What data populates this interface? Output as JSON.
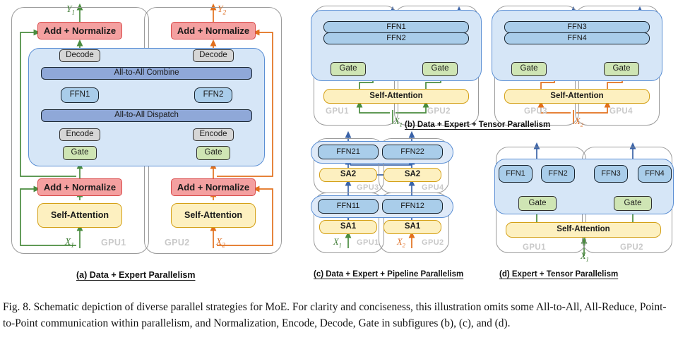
{
  "figure": {
    "caption": "Fig. 8.  Schematic depiction of diverse parallel strategies for MoE. For clarity and conciseness, this illustration omits some All-to-All, All-Reduce, Point-to-Point communication within parallelism, and Normalization, Encode, Decode, Gate in subfigures (b), (c), and (d)."
  },
  "colors": {
    "add_norm": "#f4a0a0",
    "self_attention": "#fdf0c0",
    "gate": "#cfe5b4",
    "encode_decode": "#d6d6d6",
    "ffn": "#a9cdea",
    "all_to_all": "#8fa8d8",
    "moe_region": "#d6e6f7",
    "gpu_border": "#9b9b9b",
    "gpu_label": "#c9c9c9",
    "flow_green": "#4a8c3f",
    "flow_orange": "#e2701c",
    "flow_blue": "#3a63a8",
    "flow_gray": "#9b9b9b"
  },
  "panel_a": {
    "caption": "(a) Data + Expert Parallelism",
    "gpus": [
      "GPU1",
      "GPU2"
    ],
    "inputs": [
      "X",
      "X"
    ],
    "input_subs": [
      "1",
      "2"
    ],
    "outputs": [
      "Y",
      "Y"
    ],
    "output_subs": [
      "1",
      "2"
    ],
    "left_column": {
      "add_norm_top": "Add + Normalize",
      "decode": "Decode",
      "ffn": "FFN1",
      "encode": "Encode",
      "gate": "Gate",
      "add_norm_bottom": "Add + Normalize",
      "self_attention": "Self-Attention"
    },
    "right_column": {
      "add_norm_top": "Add + Normalize",
      "decode": "Decode",
      "ffn": "FFN2",
      "encode": "Encode",
      "gate": "Gate",
      "add_norm_bottom": "Add + Normalize",
      "self_attention": "Self-Attention"
    },
    "shared_bars": {
      "combine": "All-to-All Combine",
      "dispatch": "All-to-All Dispatch"
    }
  },
  "panel_b": {
    "caption": "(b) Data + Expert + Tensor Parallelism",
    "gpus": [
      "GPU1",
      "GPU2",
      "GPU3",
      "GPU4"
    ],
    "inputs": [
      "X",
      "X"
    ],
    "input_subs": [
      "1",
      "2"
    ],
    "group_left": {
      "ffn_top": "FFN1",
      "ffn_bottom": "FFN2",
      "gates": [
        "Gate",
        "Gate"
      ],
      "self_attention": "Self-Attention"
    },
    "group_right": {
      "ffn_top": "FFN3",
      "ffn_bottom": "FFN4",
      "gates": [
        "Gate",
        "Gate"
      ],
      "self_attention": "Self-Attention"
    }
  },
  "panel_c": {
    "caption": "(c) Data + Expert + Pipeline Parallelism",
    "gpus": [
      "GPU1",
      "GPU2",
      "GPU3",
      "GPU4"
    ],
    "inputs": [
      "X",
      "X"
    ],
    "input_subs": [
      "1",
      "2"
    ],
    "stage_two": {
      "ffn_left": "FFN21",
      "ffn_right": "FFN22",
      "sa_left": "SA2",
      "sa_right": "SA2"
    },
    "stage_one": {
      "ffn_left": "FFN11",
      "ffn_right": "FFN12",
      "sa_left": "SA1",
      "sa_right": "SA1"
    }
  },
  "panel_d": {
    "caption": "(d) Expert + Tensor Parallelism",
    "gpus": [
      "GPU1",
      "GPU2"
    ],
    "inputs": [
      "X"
    ],
    "input_subs": [
      "1"
    ],
    "ffns": [
      "FFN1",
      "FFN2",
      "FFN3",
      "FFN4"
    ],
    "gates": [
      "Gate",
      "Gate"
    ],
    "self_attention": "Self-Attention"
  }
}
